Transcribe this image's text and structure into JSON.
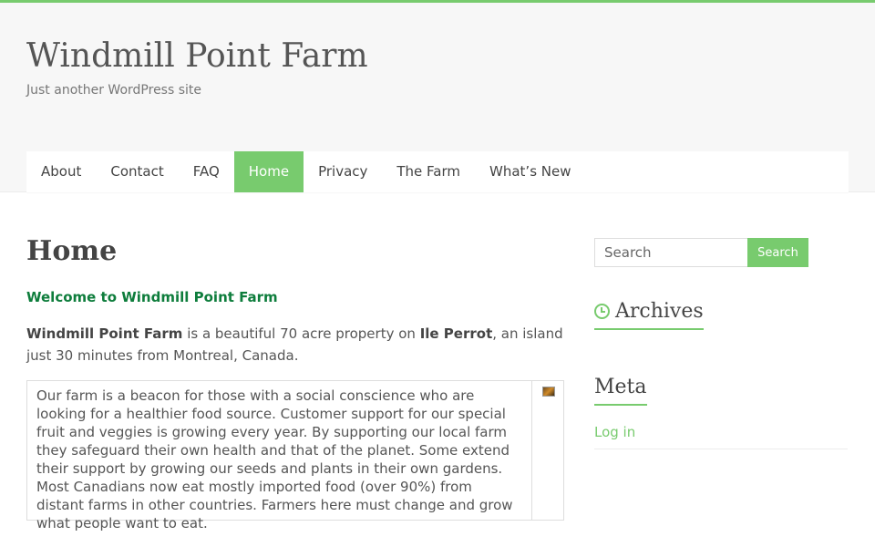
{
  "site": {
    "title": "Windmill Point Farm",
    "tagline": "Just another WordPress site"
  },
  "nav": {
    "items": [
      {
        "label": "About"
      },
      {
        "label": "Contact"
      },
      {
        "label": "FAQ"
      },
      {
        "label": "Home",
        "active": true
      },
      {
        "label": "Privacy"
      },
      {
        "label": "The Farm"
      },
      {
        "label": "What’s New"
      }
    ]
  },
  "main": {
    "title": "Home",
    "welcome": "Welcome to Windmill Point Farm",
    "intro": {
      "bold1": "Windmill Point Farm",
      "text1": " is a beautiful 70 acre property on ",
      "bold2": "Ile Perrot",
      "text2": ", an island just 30 minutes from Montreal, Canada."
    },
    "box_text": "Our farm is a beacon for those with a social conscience who are looking for a healthier food source. Customer support for our special fruit and veggies is growing every year. By supporting our local farm they safeguard their own health and that of the planet.  Some extend their support by growing our seeds and plants in their own gardens. Most Canadians now eat mostly imported food (over 90%) from distant farms in other countries. Farmers here must change and grow what people want to eat."
  },
  "sidebar": {
    "search": {
      "placeholder": "Search",
      "button": "Search"
    },
    "archives_title": "Archives",
    "meta_title": "Meta",
    "login": "Log in"
  },
  "colors": {
    "accent": "#78cb6e",
    "welcome": "#0e7d3c"
  }
}
